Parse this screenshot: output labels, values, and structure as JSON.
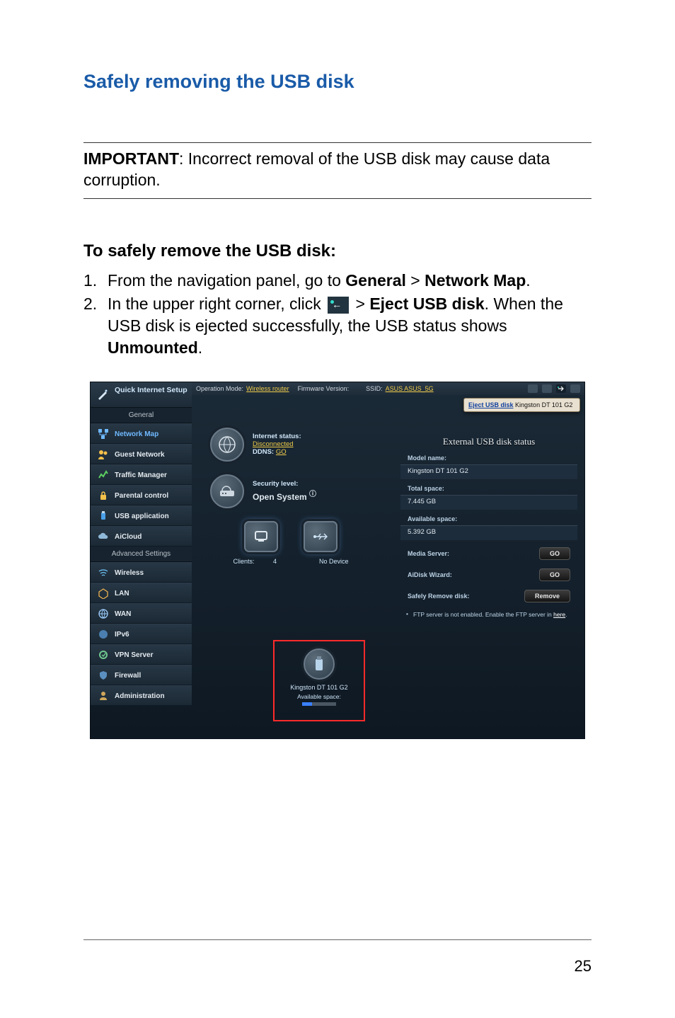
{
  "heading": "Safely removing the USB disk",
  "important": {
    "label": "IMPORTANT",
    "text": ":  Incorrect removal of the USB disk may cause data corruption."
  },
  "sub_heading": "To safely remove the USB disk:",
  "steps": {
    "s1_num": "1.",
    "s1_a": "From the navigation panel, go to ",
    "s1_b": "General",
    "s1_c": " > ",
    "s1_d": "Network Map",
    "s1_e": ".",
    "s2_num": "2.",
    "s2_a": "In the upper right corner, click ",
    "s2_b": " > ",
    "s2_c": "Eject USB disk",
    "s2_d": ". When the USB disk is ejected successfully, the USB status shows ",
    "s2_e": "Unmounted",
    "s2_f": "."
  },
  "screenshot": {
    "qis": "Quick Internet Setup",
    "section_general": "General",
    "section_advanced": "Advanced Settings",
    "nav": {
      "network_map": "Network Map",
      "guest_network": "Guest Network",
      "traffic_manager": "Traffic Manager",
      "parental_control": "Parental control",
      "usb_application": "USB application",
      "aicloud": "AiCloud",
      "wireless": "Wireless",
      "lan": "LAN",
      "wan": "WAN",
      "ipv6": "IPv6",
      "vpn_server": "VPN Server",
      "firewall": "Firewall",
      "administration": "Administration"
    },
    "topbar": {
      "op_mode_k": "Operation Mode:",
      "op_mode_v": "Wireless router",
      "fw_k": "Firmware Version:",
      "ssid_k": "SSID:",
      "ssid_v": "ASUS  ASUS_5G"
    },
    "eject_popup": {
      "link": "Eject USB disk",
      "model": "Kingston DT 101 G2"
    },
    "center": {
      "internet_status_lbl": "Internet status:",
      "internet_status_val": "Disconnected",
      "ddns_lbl": "DDNS:",
      "ddns_val": "GO",
      "security_lbl": "Security level:",
      "security_val": "Open System",
      "clients_lbl": "Clients:",
      "clients_val": "4",
      "no_device": "No Device",
      "usb_name": "Kingston DT 101 G2",
      "available_space": "Available space:"
    },
    "right": {
      "header": "External USB disk status",
      "model_lbl": "Model name:",
      "model_val": "Kingston DT 101 G2",
      "total_lbl": "Total space:",
      "total_val": "7.445 GB",
      "avail_lbl": "Available space:",
      "avail_val": "5.392 GB",
      "media_server": "Media Server:",
      "aidisk_wizard": "AiDisk Wizard:",
      "safely_remove": "Safely Remove disk:",
      "go": "GO",
      "remove": "Remove",
      "ftp_note_a": "FTP server is not enabled. Enable the FTP server in ",
      "ftp_note_b": "here",
      "ftp_note_c": "."
    }
  },
  "page_number": "25"
}
